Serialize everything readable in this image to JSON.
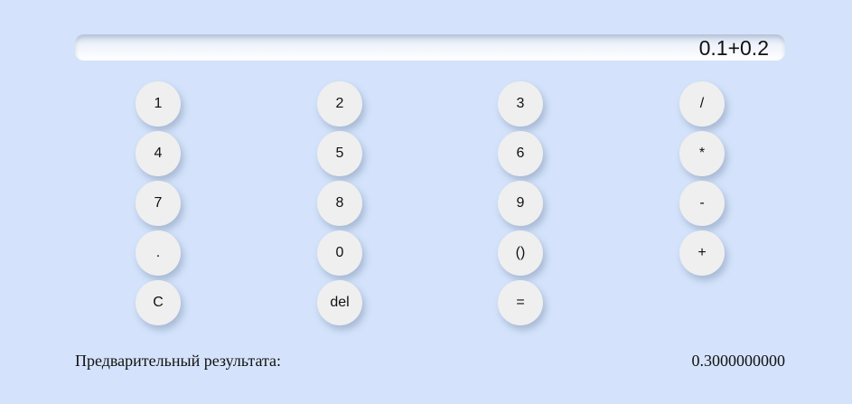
{
  "display": {
    "expression": "0.1+0.2"
  },
  "keys": {
    "one": "1",
    "two": "2",
    "three": "3",
    "divide": "/",
    "four": "4",
    "five": "5",
    "six": "6",
    "multiply": "*",
    "seven": "7",
    "eight": "8",
    "nine": "9",
    "minus": "-",
    "dot": ".",
    "zero": "0",
    "parentheses": "()",
    "plus": "+",
    "clear": "C",
    "delete": "del",
    "equals": "="
  },
  "preview": {
    "label": "Предварительный результата:",
    "value": "0.3000000000"
  },
  "colors": {
    "background": "#d4e3fb",
    "button": "#efefef",
    "text": "#111111"
  }
}
